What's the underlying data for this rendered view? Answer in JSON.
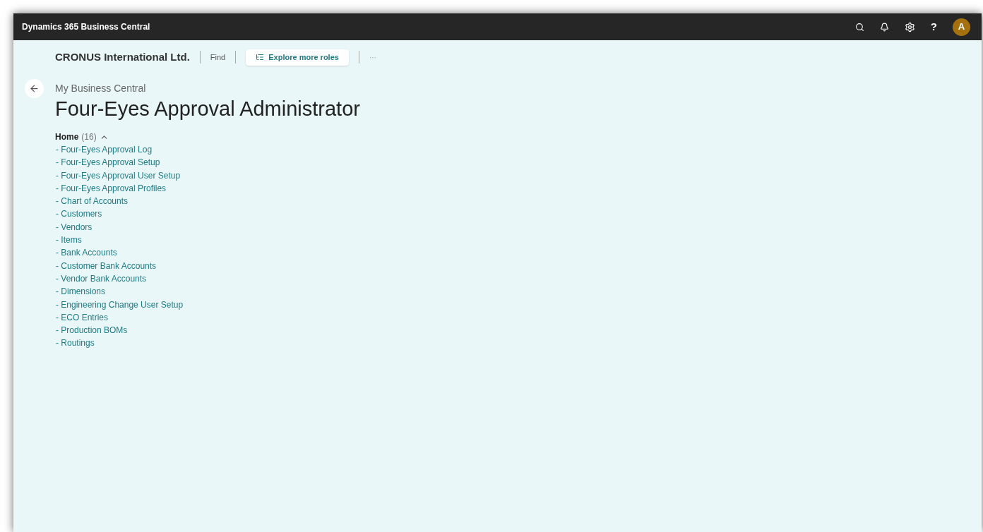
{
  "app_bar": {
    "title": "Dynamics 365 Business Central",
    "avatar": "A",
    "help": "?"
  },
  "nav": {
    "company": "CRONUS International Ltd.",
    "find": "Find",
    "explore": "Explore more roles",
    "more": "···"
  },
  "breadcrumb": "My Business Central",
  "page_title": "Four-Eyes Approval Administrator",
  "group": {
    "title": "Home",
    "count": "(16)",
    "expanded": true,
    "links": [
      "- Four-Eyes Approval Log",
      "- Four-Eyes Approval Setup",
      "- Four-Eyes Approval User Setup",
      "- Four-Eyes Approval Profiles",
      "- Chart of Accounts",
      "- Customers",
      "- Vendors",
      "- Items",
      "- Bank Accounts",
      "- Customer Bank Accounts",
      "- Vendor Bank Accounts",
      "- Dimensions",
      "- Engineering Change User Setup",
      "- ECO Entries",
      "- Production BOMs",
      "- Routings"
    ]
  }
}
